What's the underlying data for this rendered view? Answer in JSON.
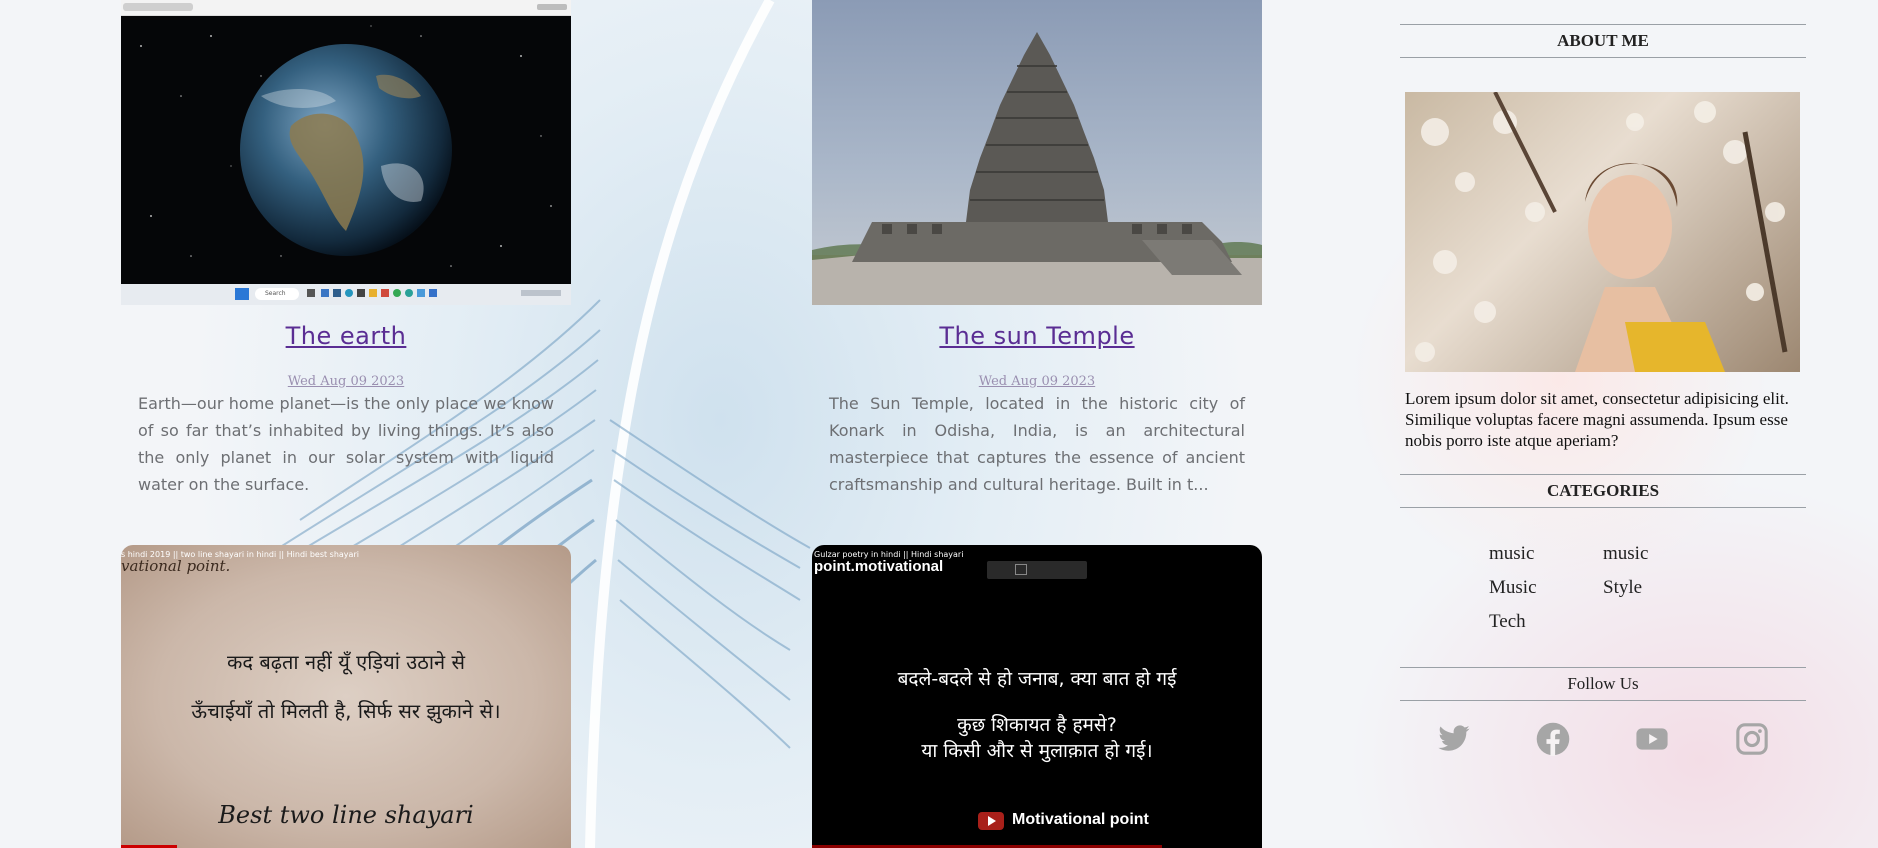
{
  "posts": [
    {
      "title": "The earth",
      "date": "Wed Aug 09 2023",
      "excerpt": "Earth—our home planet—is the only place we know of so far that’s inhabited by living things. It’s also the only planet in our solar system with liquid water on the surface.",
      "thumb_taskbar_search": "Search"
    },
    {
      "title": "The sun Temple",
      "date": "Wed Aug 09 2023",
      "excerpt": "The Sun Temple, located in the historic city of Konark in Odisha, India, is an architectural masterpiece that captures the essence of ancient craftsmanship and cultural heritage. Built in t..."
    },
    {
      "video_caption": "s hindi 2019 || two line shayari in hindi || Hindi best shayari",
      "watermark": "vational point.",
      "line1": "कद बढ़ता नहीं यूँ एड़ियां उठाने से",
      "line2": "ऊँचाईयाँ तो मिलती है, सिर्फ सर झुकाने से।",
      "footer": "Best two line shayari"
    },
    {
      "video_caption": "Gulzar poetry in hindi || Hindi shayari",
      "brand": "point.motivational",
      "line1": "बदले-बदले से हो जनाब, क्या बात हो गई",
      "line2": "कुछ शिकायत है हमसे?",
      "line3": "या किसी और से मुलाक़ात हो गई।",
      "channel": "Motivational point"
    }
  ],
  "sidebar": {
    "about_heading": "ABOUT ME",
    "about_text": "Lorem ipsum dolor sit amet, consectetur adipisicing elit. Similique voluptas facere magni assumenda. Ipsum esse nobis porro iste atque aperiam?",
    "categories_heading": "CATEGORIES",
    "categories": [
      "music",
      "music",
      "Music",
      "Style",
      "Tech"
    ],
    "follow_heading": "Follow Us",
    "social": [
      "twitter-icon",
      "facebook-icon",
      "youtube-icon",
      "instagram-icon"
    ]
  },
  "colors": {
    "title": "#5a2d93",
    "social_icon": "#a6a6a6"
  }
}
